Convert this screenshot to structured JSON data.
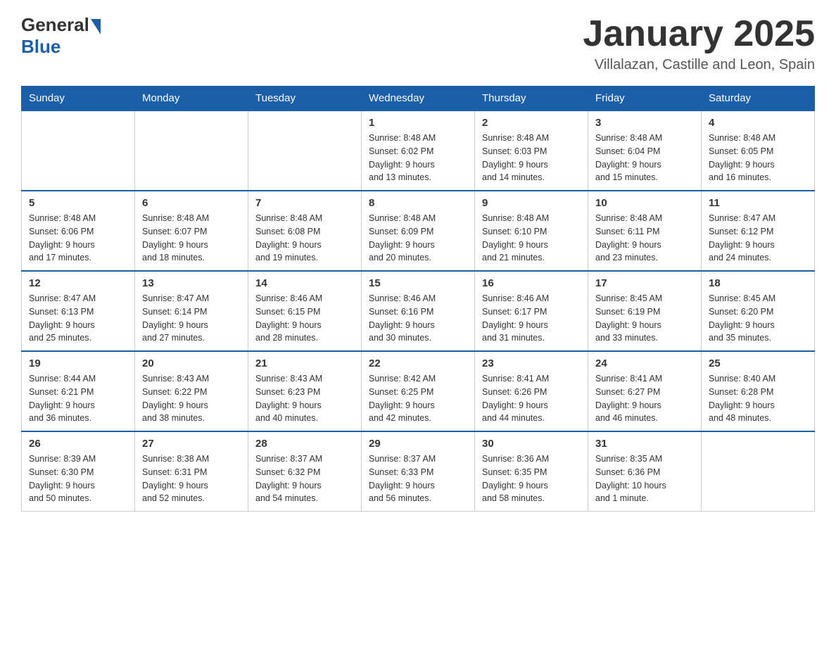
{
  "header": {
    "logo_general": "General",
    "logo_blue": "Blue",
    "month_title": "January 2025",
    "location": "Villalazan, Castille and Leon, Spain"
  },
  "weekdays": [
    "Sunday",
    "Monday",
    "Tuesday",
    "Wednesday",
    "Thursday",
    "Friday",
    "Saturday"
  ],
  "weeks": [
    [
      {
        "day": "",
        "info": ""
      },
      {
        "day": "",
        "info": ""
      },
      {
        "day": "",
        "info": ""
      },
      {
        "day": "1",
        "info": "Sunrise: 8:48 AM\nSunset: 6:02 PM\nDaylight: 9 hours\nand 13 minutes."
      },
      {
        "day": "2",
        "info": "Sunrise: 8:48 AM\nSunset: 6:03 PM\nDaylight: 9 hours\nand 14 minutes."
      },
      {
        "day": "3",
        "info": "Sunrise: 8:48 AM\nSunset: 6:04 PM\nDaylight: 9 hours\nand 15 minutes."
      },
      {
        "day": "4",
        "info": "Sunrise: 8:48 AM\nSunset: 6:05 PM\nDaylight: 9 hours\nand 16 minutes."
      }
    ],
    [
      {
        "day": "5",
        "info": "Sunrise: 8:48 AM\nSunset: 6:06 PM\nDaylight: 9 hours\nand 17 minutes."
      },
      {
        "day": "6",
        "info": "Sunrise: 8:48 AM\nSunset: 6:07 PM\nDaylight: 9 hours\nand 18 minutes."
      },
      {
        "day": "7",
        "info": "Sunrise: 8:48 AM\nSunset: 6:08 PM\nDaylight: 9 hours\nand 19 minutes."
      },
      {
        "day": "8",
        "info": "Sunrise: 8:48 AM\nSunset: 6:09 PM\nDaylight: 9 hours\nand 20 minutes."
      },
      {
        "day": "9",
        "info": "Sunrise: 8:48 AM\nSunset: 6:10 PM\nDaylight: 9 hours\nand 21 minutes."
      },
      {
        "day": "10",
        "info": "Sunrise: 8:48 AM\nSunset: 6:11 PM\nDaylight: 9 hours\nand 23 minutes."
      },
      {
        "day": "11",
        "info": "Sunrise: 8:47 AM\nSunset: 6:12 PM\nDaylight: 9 hours\nand 24 minutes."
      }
    ],
    [
      {
        "day": "12",
        "info": "Sunrise: 8:47 AM\nSunset: 6:13 PM\nDaylight: 9 hours\nand 25 minutes."
      },
      {
        "day": "13",
        "info": "Sunrise: 8:47 AM\nSunset: 6:14 PM\nDaylight: 9 hours\nand 27 minutes."
      },
      {
        "day": "14",
        "info": "Sunrise: 8:46 AM\nSunset: 6:15 PM\nDaylight: 9 hours\nand 28 minutes."
      },
      {
        "day": "15",
        "info": "Sunrise: 8:46 AM\nSunset: 6:16 PM\nDaylight: 9 hours\nand 30 minutes."
      },
      {
        "day": "16",
        "info": "Sunrise: 8:46 AM\nSunset: 6:17 PM\nDaylight: 9 hours\nand 31 minutes."
      },
      {
        "day": "17",
        "info": "Sunrise: 8:45 AM\nSunset: 6:19 PM\nDaylight: 9 hours\nand 33 minutes."
      },
      {
        "day": "18",
        "info": "Sunrise: 8:45 AM\nSunset: 6:20 PM\nDaylight: 9 hours\nand 35 minutes."
      }
    ],
    [
      {
        "day": "19",
        "info": "Sunrise: 8:44 AM\nSunset: 6:21 PM\nDaylight: 9 hours\nand 36 minutes."
      },
      {
        "day": "20",
        "info": "Sunrise: 8:43 AM\nSunset: 6:22 PM\nDaylight: 9 hours\nand 38 minutes."
      },
      {
        "day": "21",
        "info": "Sunrise: 8:43 AM\nSunset: 6:23 PM\nDaylight: 9 hours\nand 40 minutes."
      },
      {
        "day": "22",
        "info": "Sunrise: 8:42 AM\nSunset: 6:25 PM\nDaylight: 9 hours\nand 42 minutes."
      },
      {
        "day": "23",
        "info": "Sunrise: 8:41 AM\nSunset: 6:26 PM\nDaylight: 9 hours\nand 44 minutes."
      },
      {
        "day": "24",
        "info": "Sunrise: 8:41 AM\nSunset: 6:27 PM\nDaylight: 9 hours\nand 46 minutes."
      },
      {
        "day": "25",
        "info": "Sunrise: 8:40 AM\nSunset: 6:28 PM\nDaylight: 9 hours\nand 48 minutes."
      }
    ],
    [
      {
        "day": "26",
        "info": "Sunrise: 8:39 AM\nSunset: 6:30 PM\nDaylight: 9 hours\nand 50 minutes."
      },
      {
        "day": "27",
        "info": "Sunrise: 8:38 AM\nSunset: 6:31 PM\nDaylight: 9 hours\nand 52 minutes."
      },
      {
        "day": "28",
        "info": "Sunrise: 8:37 AM\nSunset: 6:32 PM\nDaylight: 9 hours\nand 54 minutes."
      },
      {
        "day": "29",
        "info": "Sunrise: 8:37 AM\nSunset: 6:33 PM\nDaylight: 9 hours\nand 56 minutes."
      },
      {
        "day": "30",
        "info": "Sunrise: 8:36 AM\nSunset: 6:35 PM\nDaylight: 9 hours\nand 58 minutes."
      },
      {
        "day": "31",
        "info": "Sunrise: 8:35 AM\nSunset: 6:36 PM\nDaylight: 10 hours\nand 1 minute."
      },
      {
        "day": "",
        "info": ""
      }
    ]
  ]
}
